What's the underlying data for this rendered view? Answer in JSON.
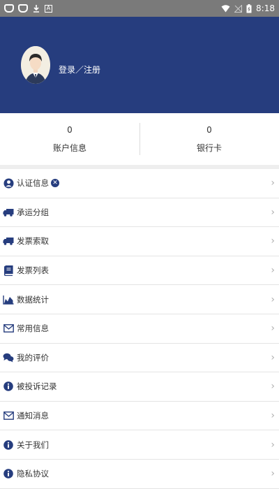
{
  "status_bar": {
    "time": "8:18",
    "icons_left": [
      "bug-icon",
      "bug-icon",
      "download-icon",
      "a-icon"
    ],
    "icons_right": [
      "wifi-icon",
      "no-signal-icon",
      "battery-icon"
    ]
  },
  "header": {
    "login_label": "登录／注册",
    "background": "#263d7e"
  },
  "stats": [
    {
      "value": "0",
      "label": "账户信息"
    },
    {
      "value": "0",
      "label": "银行卡"
    }
  ],
  "menu": {
    "items": [
      {
        "label": "认证信息",
        "icon": "user-badge-icon"
      },
      {
        "label": "承运分组",
        "icon": "truck-icon"
      },
      {
        "label": "发票索取",
        "icon": "truck-icon"
      },
      {
        "label": "发票列表",
        "icon": "book-icon"
      },
      {
        "label": "数据统计",
        "icon": "area-chart-icon"
      },
      {
        "label": "常用信息",
        "icon": "envelope-icon"
      },
      {
        "label": "我的评价",
        "icon": "chat-icon"
      },
      {
        "label": "被投诉记录",
        "icon": "info-icon"
      },
      {
        "label": "通知消息",
        "icon": "envelope-icon"
      },
      {
        "label": "关于我们",
        "icon": "info-icon"
      },
      {
        "label": "隐私协议",
        "icon": "info-icon"
      }
    ],
    "chevron": "›",
    "verify_badge": "✕"
  },
  "colors": {
    "brand": "#263d7e",
    "icon": "#263d7e"
  }
}
